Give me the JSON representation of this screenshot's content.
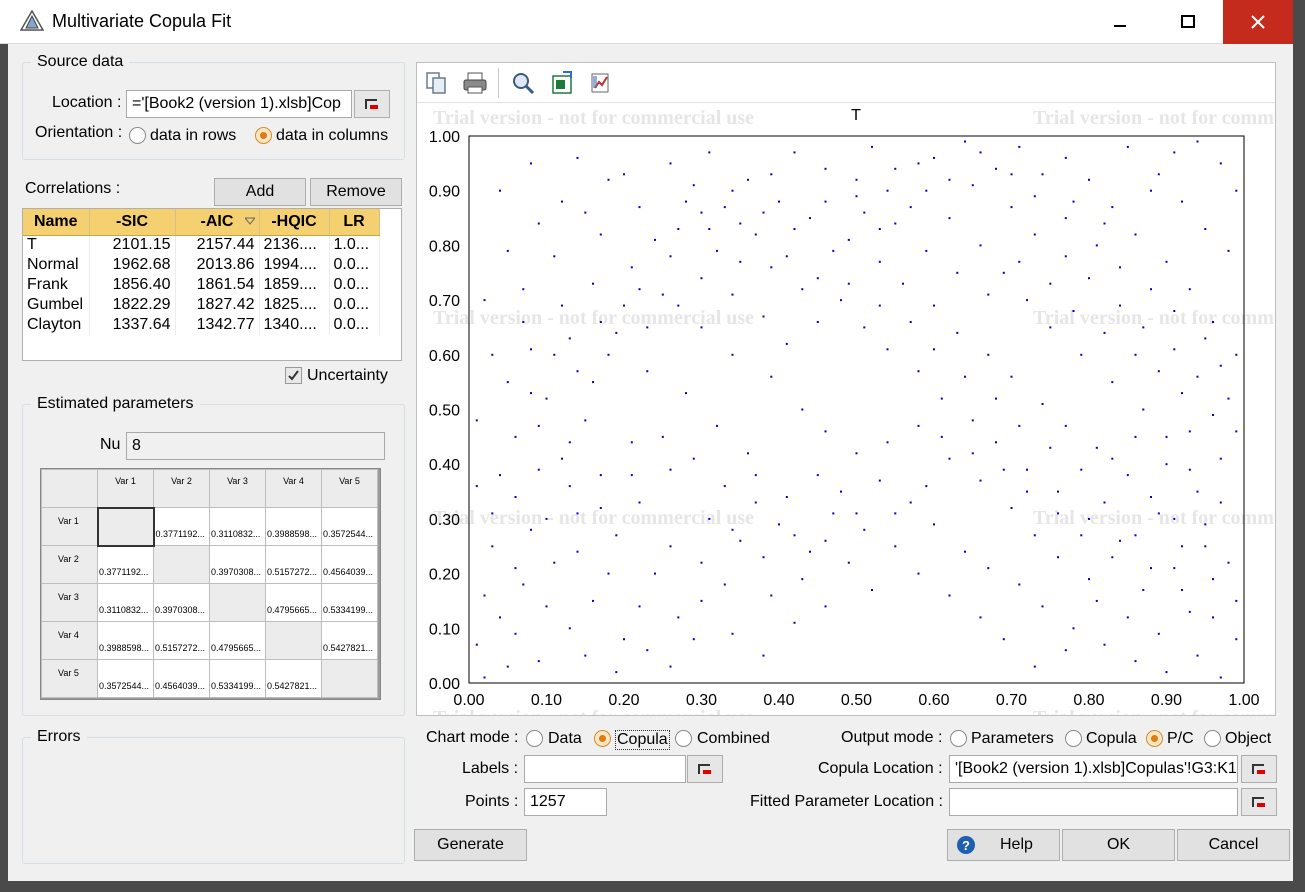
{
  "window": {
    "title": "Multivariate Copula Fit"
  },
  "source": {
    "legend": "Source data",
    "location_label": "Location :",
    "location_value": "='[Book2 (version 1).xlsb]Cop",
    "orientation_label": "Orientation :",
    "rows_label": "data in rows",
    "columns_label": "data in columns",
    "orientation_selected": "data in columns"
  },
  "correlations": {
    "label": "Correlations :",
    "add_label": "Add",
    "remove_label": "Remove",
    "columns": [
      "Name",
      "-SIC",
      "-AIC",
      "-HQIC",
      "LR"
    ],
    "sorted_column": "-AIC",
    "rows": [
      [
        "T",
        "2101.15",
        "2157.44",
        "2136....",
        "1.0..."
      ],
      [
        "Normal",
        "1962.68",
        "2013.86",
        "1994....",
        "0.0..."
      ],
      [
        "Frank",
        "1856.40",
        "1861.54",
        "1859....",
        "0.0..."
      ],
      [
        "Gumbel",
        "1822.29",
        "1827.42",
        "1825....",
        "0.0..."
      ],
      [
        "Clayton",
        "1337.64",
        "1342.77",
        "1340....",
        "0.0..."
      ]
    ],
    "uncertainty_label": "Uncertainty",
    "uncertainty_checked": true
  },
  "params": {
    "legend": "Estimated parameters",
    "nu_label": "Nu",
    "nu_value": "8",
    "headers": [
      "Var 1",
      "Var 2",
      "Var 3",
      "Var 4",
      "Var 5"
    ],
    "matrix": [
      [
        "",
        "0.3771192...",
        "0.3110832...",
        "0.3988598...",
        "0.3572544..."
      ],
      [
        "0.3771192...",
        "",
        "0.3970308...",
        "0.5157272...",
        "0.4564039..."
      ],
      [
        "0.3110832...",
        "0.3970308...",
        "",
        "0.4795665...",
        "0.5334199..."
      ],
      [
        "0.3988598...",
        "0.5157272...",
        "0.4795665...",
        "",
        "0.5427821..."
      ],
      [
        "0.3572544...",
        "0.4564039...",
        "0.5334199...",
        "0.5427821...",
        ""
      ]
    ]
  },
  "errors": {
    "legend": "Errors"
  },
  "toolbar": {
    "icons": [
      "copy-icon",
      "print-icon",
      "zoom-icon",
      "excel-export-icon",
      "chart-settings-icon"
    ]
  },
  "chart_data": {
    "type": "scatter",
    "title": "T",
    "watermark": "Trial version - not for commercial use",
    "xlim": [
      0,
      1
    ],
    "ylim": [
      0,
      1
    ],
    "x_ticks": [
      "0.00",
      "0.10",
      "0.20",
      "0.30",
      "0.40",
      "0.50",
      "0.60",
      "0.70",
      "0.80",
      "0.90",
      "1.00"
    ],
    "y_ticks": [
      "0.00",
      "0.10",
      "0.20",
      "0.30",
      "0.40",
      "0.50",
      "0.60",
      "0.70",
      "0.80",
      "0.90",
      "1.00"
    ],
    "point_color": "#0000cc",
    "n_points": 1257,
    "points": [
      [
        0.02,
        0.01
      ],
      [
        0.05,
        0.03
      ],
      [
        0.01,
        0.07
      ],
      [
        0.09,
        0.04
      ],
      [
        0.13,
        0.1
      ],
      [
        0.04,
        0.12
      ],
      [
        0.07,
        0.18
      ],
      [
        0.11,
        0.22
      ],
      [
        0.16,
        0.15
      ],
      [
        0.2,
        0.08
      ],
      [
        0.03,
        0.25
      ],
      [
        0.08,
        0.28
      ],
      [
        0.14,
        0.31
      ],
      [
        0.19,
        0.27
      ],
      [
        0.24,
        0.2
      ],
      [
        0.27,
        0.12
      ],
      [
        0.22,
        0.33
      ],
      [
        0.17,
        0.38
      ],
      [
        0.12,
        0.41
      ],
      [
        0.06,
        0.45
      ],
      [
        0.1,
        0.52
      ],
      [
        0.15,
        0.48
      ],
      [
        0.21,
        0.44
      ],
      [
        0.26,
        0.39
      ],
      [
        0.31,
        0.3
      ],
      [
        0.35,
        0.26
      ],
      [
        0.33,
        0.18
      ],
      [
        0.29,
        0.08
      ],
      [
        0.38,
        0.05
      ],
      [
        0.42,
        0.11
      ],
      [
        0.4,
        0.29
      ],
      [
        0.37,
        0.33
      ],
      [
        0.44,
        0.24
      ],
      [
        0.47,
        0.31
      ],
      [
        0.36,
        0.42
      ],
      [
        0.32,
        0.47
      ],
      [
        0.28,
        0.53
      ],
      [
        0.23,
        0.57
      ],
      [
        0.18,
        0.6
      ],
      [
        0.13,
        0.63
      ],
      [
        0.07,
        0.66
      ],
      [
        0.02,
        0.7
      ],
      [
        0.05,
        0.79
      ],
      [
        0.09,
        0.84
      ],
      [
        0.04,
        0.9
      ],
      [
        0.08,
        0.95
      ],
      [
        0.14,
        0.96
      ],
      [
        0.12,
        0.88
      ],
      [
        0.17,
        0.82
      ],
      [
        0.21,
        0.76
      ],
      [
        0.25,
        0.71
      ],
      [
        0.3,
        0.65
      ],
      [
        0.34,
        0.6
      ],
      [
        0.39,
        0.56
      ],
      [
        0.43,
        0.5
      ],
      [
        0.46,
        0.46
      ],
      [
        0.5,
        0.42
      ],
      [
        0.53,
        0.37
      ],
      [
        0.57,
        0.33
      ],
      [
        0.6,
        0.29
      ],
      [
        0.64,
        0.24
      ],
      [
        0.67,
        0.21
      ],
      [
        0.71,
        0.18
      ],
      [
        0.74,
        0.14
      ],
      [
        0.78,
        0.1
      ],
      [
        0.82,
        0.07
      ],
      [
        0.86,
        0.04
      ],
      [
        0.9,
        0.02
      ],
      [
        0.94,
        0.05
      ],
      [
        0.97,
        0.01
      ],
      [
        0.99,
        0.08
      ],
      [
        0.96,
        0.12
      ],
      [
        0.92,
        0.17
      ],
      [
        0.88,
        0.21
      ],
      [
        0.84,
        0.26
      ],
      [
        0.8,
        0.3
      ],
      [
        0.76,
        0.35
      ],
      [
        0.72,
        0.39
      ],
      [
        0.68,
        0.44
      ],
      [
        0.65,
        0.48
      ],
      [
        0.61,
        0.52
      ],
      [
        0.58,
        0.57
      ],
      [
        0.54,
        0.61
      ],
      [
        0.51,
        0.65
      ],
      [
        0.48,
        0.7
      ],
      [
        0.45,
        0.74
      ],
      [
        0.41,
        0.78
      ],
      [
        0.37,
        0.82
      ],
      [
        0.33,
        0.87
      ],
      [
        0.29,
        0.91
      ],
      [
        0.26,
        0.95
      ],
      [
        0.31,
        0.97
      ],
      [
        0.36,
        0.92
      ],
      [
        0.4,
        0.88
      ],
      [
        0.44,
        0.85
      ],
      [
        0.49,
        0.81
      ],
      [
        0.53,
        0.77
      ],
      [
        0.56,
        0.73
      ],
      [
        0.6,
        0.69
      ],
      [
        0.63,
        0.64
      ],
      [
        0.67,
        0.6
      ],
      [
        0.7,
        0.56
      ],
      [
        0.74,
        0.51
      ],
      [
        0.77,
        0.47
      ],
      [
        0.81,
        0.43
      ],
      [
        0.85,
        0.38
      ],
      [
        0.88,
        0.34
      ],
      [
        0.91,
        0.3
      ],
      [
        0.95,
        0.25
      ],
      [
        0.98,
        0.22
      ],
      [
        0.97,
        0.33
      ],
      [
        0.93,
        0.39
      ],
      [
        0.9,
        0.45
      ],
      [
        0.87,
        0.5
      ],
      [
        0.83,
        0.55
      ],
      [
        0.79,
        0.6
      ],
      [
        0.75,
        0.65
      ],
      [
        0.72,
        0.7
      ],
      [
        0.69,
        0.75
      ],
      [
        0.66,
        0.8
      ],
      [
        0.62,
        0.85
      ],
      [
        0.59,
        0.9
      ],
      [
        0.55,
        0.94
      ],
      [
        0.52,
        0.98
      ],
      [
        0.6,
        0.96
      ],
      [
        0.65,
        0.91
      ],
      [
        0.7,
        0.87
      ],
      [
        0.73,
        0.82
      ],
      [
        0.77,
        0.78
      ],
      [
        0.8,
        0.74
      ],
      [
        0.84,
        0.69
      ],
      [
        0.87,
        0.65
      ],
      [
        0.91,
        0.61
      ],
      [
        0.94,
        0.56
      ],
      [
        0.98,
        0.52
      ],
      [
        0.99,
        0.6
      ],
      [
        0.96,
        0.66
      ],
      [
        0.93,
        0.72
      ],
      [
        0.9,
        0.77
      ],
      [
        0.86,
        0.82
      ],
      [
        0.83,
        0.87
      ],
      [
        0.8,
        0.92
      ],
      [
        0.77,
        0.96
      ],
      [
        0.85,
        0.98
      ],
      [
        0.89,
        0.93
      ],
      [
        0.92,
        0.88
      ],
      [
        0.95,
        0.83
      ],
      [
        0.98,
        0.79
      ],
      [
        0.99,
        0.9
      ],
      [
        0.97,
        0.95
      ],
      [
        0.94,
        0.99
      ],
      [
        0.91,
        0.97
      ],
      [
        0.88,
        0.9
      ],
      [
        0.82,
        0.84
      ],
      [
        0.78,
        0.88
      ],
      [
        0.74,
        0.93
      ],
      [
        0.71,
        0.98
      ],
      [
        0.68,
        0.94
      ],
      [
        0.64,
        0.99
      ],
      [
        0.57,
        0.87
      ],
      [
        0.53,
        0.83
      ],
      [
        0.5,
        0.89
      ],
      [
        0.46,
        0.94
      ],
      [
        0.42,
        0.97
      ],
      [
        0.39,
        0.93
      ],
      [
        0.35,
        0.84
      ],
      [
        0.32,
        0.79
      ],
      [
        0.27,
        0.83
      ],
      [
        0.22,
        0.87
      ],
      [
        0.18,
        0.92
      ],
      [
        0.15,
        0.86
      ],
      [
        0.11,
        0.78
      ],
      [
        0.07,
        0.72
      ],
      [
        0.03,
        0.6
      ],
      [
        0.01,
        0.48
      ],
      [
        0.04,
        0.38
      ],
      [
        0.02,
        0.16
      ],
      [
        0.06,
        0.09
      ],
      [
        0.1,
        0.14
      ],
      [
        0.15,
        0.05
      ],
      [
        0.19,
        0.02
      ],
      [
        0.23,
        0.06
      ],
      [
        0.26,
        0.03
      ],
      [
        0.3,
        0.15
      ],
      [
        0.34,
        0.09
      ],
      [
        0.39,
        0.16
      ],
      [
        0.43,
        0.19
      ],
      [
        0.46,
        0.14
      ],
      [
        0.49,
        0.22
      ],
      [
        0.52,
        0.17
      ],
      [
        0.55,
        0.25
      ],
      [
        0.58,
        0.2
      ],
      [
        0.62,
        0.16
      ],
      [
        0.66,
        0.12
      ],
      [
        0.69,
        0.08
      ],
      [
        0.73,
        0.03
      ],
      [
        0.77,
        0.06
      ],
      [
        0.81,
        0.15
      ],
      [
        0.85,
        0.12
      ],
      [
        0.89,
        0.09
      ],
      [
        0.93,
        0.13
      ],
      [
        0.96,
        0.19
      ],
      [
        0.99,
        0.15
      ],
      [
        0.95,
        0.29
      ],
      [
        0.92,
        0.25
      ],
      [
        0.89,
        0.31
      ],
      [
        0.86,
        0.27
      ],
      [
        0.82,
        0.33
      ],
      [
        0.79,
        0.39
      ],
      [
        0.75,
        0.43
      ],
      [
        0.71,
        0.47
      ],
      [
        0.68,
        0.52
      ],
      [
        0.64,
        0.56
      ],
      [
        0.6,
        0.61
      ],
      [
        0.57,
        0.66
      ],
      [
        0.53,
        0.69
      ],
      [
        0.49,
        0.73
      ],
      [
        0.45,
        0.66
      ],
      [
        0.41,
        0.62
      ],
      [
        0.38,
        0.67
      ],
      [
        0.34,
        0.71
      ],
      [
        0.3,
        0.74
      ],
      [
        0.27,
        0.69
      ],
      [
        0.23,
        0.65
      ],
      [
        0.2,
        0.69
      ],
      [
        0.16,
        0.73
      ],
      [
        0.12,
        0.69
      ],
      [
        0.08,
        0.61
      ],
      [
        0.05,
        0.55
      ],
      [
        0.09,
        0.47
      ],
      [
        0.13,
        0.36
      ],
      [
        0.17,
        0.32
      ],
      [
        0.21,
        0.38
      ],
      [
        0.25,
        0.45
      ],
      [
        0.29,
        0.41
      ],
      [
        0.33,
        0.36
      ],
      [
        0.37,
        0.38
      ],
      [
        0.41,
        0.34
      ],
      [
        0.45,
        0.38
      ],
      [
        0.48,
        0.35
      ],
      [
        0.51,
        0.28
      ],
      [
        0.55,
        0.31
      ],
      [
        0.59,
        0.36
      ],
      [
        0.62,
        0.41
      ],
      [
        0.66,
        0.37
      ],
      [
        0.7,
        0.32
      ],
      [
        0.73,
        0.27
      ],
      [
        0.76,
        0.23
      ],
      [
        0.8,
        0.19
      ],
      [
        0.83,
        0.23
      ],
      [
        0.87,
        0.17
      ],
      [
        0.91,
        0.21
      ],
      [
        0.94,
        0.35
      ],
      [
        0.97,
        0.41
      ],
      [
        0.99,
        0.46
      ],
      [
        0.96,
        0.49
      ],
      [
        0.92,
        0.53
      ],
      [
        0.89,
        0.57
      ],
      [
        0.86,
        0.6
      ],
      [
        0.82,
        0.64
      ],
      [
        0.78,
        0.68
      ],
      [
        0.75,
        0.73
      ],
      [
        0.71,
        0.77
      ],
      [
        0.67,
        0.71
      ],
      [
        0.63,
        0.75
      ],
      [
        0.59,
        0.79
      ],
      [
        0.55,
        0.84
      ],
      [
        0.51,
        0.86
      ],
      [
        0.47,
        0.79
      ],
      [
        0.43,
        0.72
      ],
      [
        0.39,
        0.76
      ],
      [
        0.35,
        0.77
      ],
      [
        0.31,
        0.83
      ],
      [
        0.28,
        0.88
      ],
      [
        0.24,
        0.81
      ],
      [
        0.2,
        0.93
      ],
      [
        0.17,
        0.66
      ],
      [
        0.14,
        0.57
      ],
      [
        0.11,
        0.6
      ],
      [
        0.08,
        0.53
      ],
      [
        0.06,
        0.34
      ],
      [
        0.1,
        0.3
      ],
      [
        0.14,
        0.24
      ],
      [
        0.18,
        0.2
      ],
      [
        0.22,
        0.14
      ],
      [
        0.26,
        0.25
      ],
      [
        0.3,
        0.22
      ],
      [
        0.34,
        0.28
      ],
      [
        0.38,
        0.23
      ],
      [
        0.42,
        0.27
      ],
      [
        0.46,
        0.26
      ],
      [
        0.5,
        0.31
      ],
      [
        0.54,
        0.44
      ],
      [
        0.58,
        0.47
      ],
      [
        0.61,
        0.45
      ],
      [
        0.65,
        0.42
      ],
      [
        0.69,
        0.39
      ],
      [
        0.72,
        0.35
      ],
      [
        0.76,
        0.31
      ],
      [
        0.79,
        0.27
      ],
      [
        0.83,
        0.41
      ],
      [
        0.86,
        0.45
      ],
      [
        0.9,
        0.4
      ],
      [
        0.93,
        0.46
      ],
      [
        0.97,
        0.58
      ],
      [
        0.95,
        0.63
      ],
      [
        0.91,
        0.68
      ],
      [
        0.88,
        0.72
      ],
      [
        0.84,
        0.76
      ],
      [
        0.81,
        0.8
      ],
      [
        0.77,
        0.85
      ],
      [
        0.73,
        0.89
      ],
      [
        0.7,
        0.93
      ],
      [
        0.66,
        0.97
      ],
      [
        0.62,
        0.92
      ],
      [
        0.58,
        0.95
      ],
      [
        0.54,
        0.9
      ],
      [
        0.5,
        0.92
      ],
      [
        0.46,
        0.88
      ],
      [
        0.42,
        0.83
      ],
      [
        0.38,
        0.86
      ],
      [
        0.34,
        0.9
      ],
      [
        0.3,
        0.86
      ],
      [
        0.26,
        0.78
      ],
      [
        0.22,
        0.72
      ],
      [
        0.19,
        0.64
      ],
      [
        0.16,
        0.55
      ],
      [
        0.13,
        0.44
      ],
      [
        0.09,
        0.39
      ],
      [
        0.06,
        0.21
      ],
      [
        0.03,
        0.31
      ],
      [
        0.01,
        0.36
      ]
    ]
  }
}
